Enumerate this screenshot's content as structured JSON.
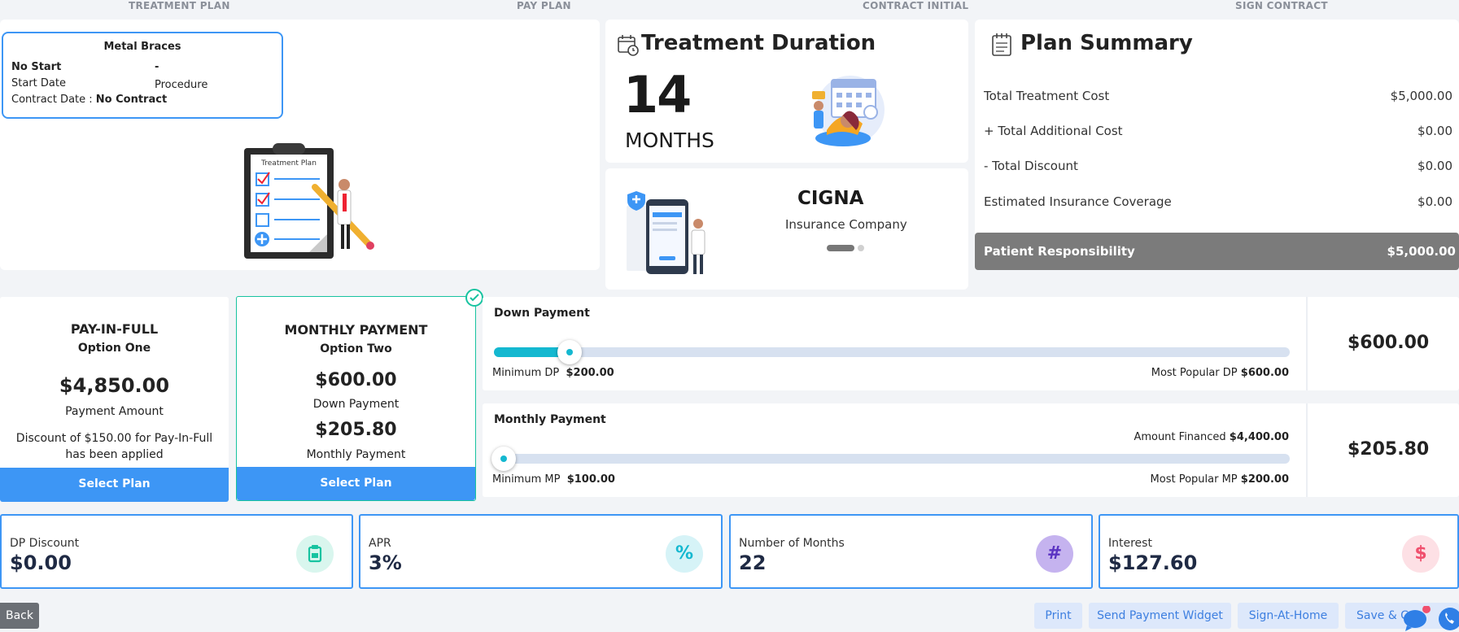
{
  "steps": [
    "TREATMENT PLAN",
    "PAY PLAN",
    "CONTRACT INITIAL",
    "SIGN CONTRACT"
  ],
  "treatment_plan": {
    "title": "Metal Braces",
    "start_label": "No Start",
    "start_value": "-",
    "start_date_label": "Start Date",
    "procedure_label": "Procedure",
    "contract_date_label": "Contract Date : ",
    "contract_date_value": "No Contract",
    "illustration_label": "Treatment Plan"
  },
  "duration": {
    "title": "Treatment Duration",
    "value": "14",
    "unit": "MONTHS"
  },
  "insurance": {
    "name": "CIGNA",
    "label": "Insurance Company"
  },
  "summary": {
    "title": "Plan Summary",
    "rows": [
      {
        "label": "Total Treatment Cost",
        "value": "$5,000.00"
      },
      {
        "label": "+ Total Additional Cost",
        "value": "$0.00"
      },
      {
        "label": "- Total Discount",
        "value": "$0.00"
      },
      {
        "label": "Estimated Insurance Coverage",
        "value": "$0.00"
      }
    ],
    "responsibility_label": "Patient Responsibility",
    "responsibility_value": "$5,000.00"
  },
  "plans": [
    {
      "title": "PAY-IN-FULL",
      "subtitle": "Option One",
      "amount": "$4,850.00",
      "amount_label": "Payment Amount",
      "note": "Discount of $150.00 for Pay-In-Full has been applied",
      "button": "Select Plan"
    },
    {
      "title": "MONTHLY PAYMENT",
      "subtitle": "Option Two",
      "down_payment": "$600.00",
      "down_label": "Down Payment",
      "monthly": "$205.80",
      "monthly_label": "Monthly Payment",
      "button": "Select Plan",
      "selected": true
    }
  ],
  "down_payment": {
    "title": "Down Payment",
    "min_label": "Minimum DP",
    "min_value": "$200.00",
    "popular_label": "Most Popular DP",
    "popular_value": "$600.00",
    "value": "$600.00",
    "fill_fraction": 0.095
  },
  "monthly_payment": {
    "title": "Monthly Payment",
    "financed_label": "Amount Financed",
    "financed_value": "$4,400.00",
    "min_label": "Minimum MP",
    "min_value": "$100.00",
    "popular_label": "Most Popular MP",
    "popular_value": "$200.00",
    "value": "$205.80",
    "fill_fraction": 0.0
  },
  "stats": [
    {
      "label": "DP Discount",
      "value": "$0.00",
      "icon": "clipboard-icon",
      "color": "#17c3a0"
    },
    {
      "label": "APR",
      "value": "3%",
      "icon": "percent-icon",
      "color": "#14b8d0"
    },
    {
      "label": "Number of Months",
      "value": "22",
      "icon": "hash-icon",
      "color": "#7b4fd6"
    },
    {
      "label": "Interest",
      "value": "$127.60",
      "icon": "dollar-icon",
      "color": "#f0506e"
    }
  ],
  "footer": {
    "back": "Back",
    "print": "Print",
    "send_widget": "Send Payment Widget",
    "sign_home": "Sign-At-Home",
    "save": "Save & C"
  },
  "colors": {
    "primary": "#3d96f5",
    "accent": "#14b8d0",
    "selected_border": "#17c3a0"
  }
}
